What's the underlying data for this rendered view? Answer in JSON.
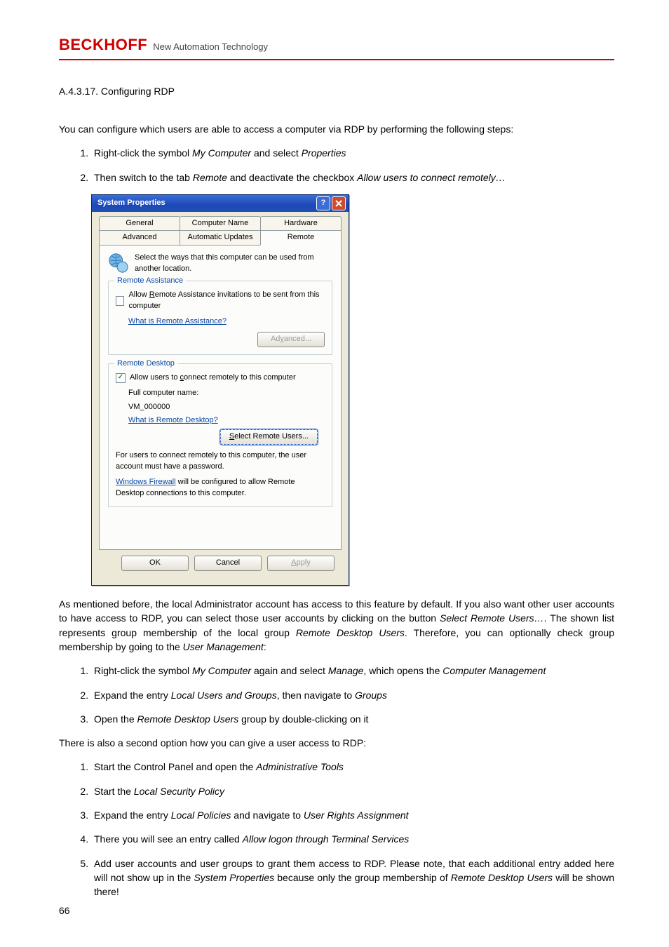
{
  "header": {
    "brand": "BECKHOFF",
    "tagline": "New Automation Technology"
  },
  "doc": {
    "section_heading": "A.4.3.17.  Configuring RDP",
    "intro": "You can configure which users are able to access a computer via RDP by performing the following steps:",
    "steps_a": {
      "s1_a": "Right-click the symbol ",
      "s1_b": "My Computer",
      "s1_c": " and select ",
      "s1_d": "Properties",
      "s2_a": "Then switch to the tab ",
      "s2_b": "Remote",
      "s2_c": " and deactivate the checkbox ",
      "s2_d": "Allow users to connect remotely…"
    },
    "after_dialog_a": "As mentioned before, the local Administrator account has access to this feature by default. If you also want other user accounts to have access to RDP, you can select those user accounts by clicking on the button ",
    "after_dialog_b": "Select Remote Users…",
    "after_dialog_c": ". The shown list represents group membership of the local group ",
    "after_dialog_d": "Remote Desktop Users",
    "after_dialog_e": ". Therefore, you can optionally check group membership by going to the ",
    "after_dialog_f": "User Management",
    "after_dialog_g": ":",
    "steps_b": {
      "s1_a": "Right-click the symbol ",
      "s1_b": "My Computer",
      "s1_c": " again and select ",
      "s1_d": "Manage",
      "s1_e": ", which opens the ",
      "s1_f": "Computer Management",
      "s2_a": "Expand the entry ",
      "s2_b": "Local Users and Groups",
      "s2_c": ", then navigate to ",
      "s2_d": "Groups",
      "s3_a": "Open the ",
      "s3_b": "Remote Desktop Users",
      "s3_c": " group by double-clicking on it"
    },
    "second_option": "There is also a second option how you can give a user access to RDP:",
    "steps_c": {
      "s1_a": "Start the Control Panel and open the ",
      "s1_b": "Administrative Tools",
      "s2_a": "Start the ",
      "s2_b": "Local Security Policy",
      "s3_a": "Expand the entry ",
      "s3_b": "Local Policies",
      "s3_c": " and navigate to ",
      "s3_d": "User Rights Assignment",
      "s4_a": "There you will see an entry called ",
      "s4_b": "Allow logon through Terminal Services",
      "s5_a": "Add user accounts and user groups to grant them access to RDP. Please note, that each additional entry added here will not show up in the ",
      "s5_b": "System Properties",
      "s5_c": " because only the group membership of ",
      "s5_d": "Remote Desktop Users",
      "s5_e": " will be shown there!"
    },
    "page_number": "66"
  },
  "dialog": {
    "title": "System Properties",
    "tabs_top": [
      "General",
      "Computer Name",
      "Hardware"
    ],
    "tabs_bot": [
      "Advanced",
      "Automatic Updates",
      "Remote"
    ],
    "active_tab": "Remote",
    "intro": "Select the ways that this computer can be used from another location.",
    "grp1": {
      "legend": "Remote Assistance",
      "chk_label_pre": "Allow ",
      "chk_label_u": "R",
      "chk_label_post": "emote Assistance invitations to be sent from this computer",
      "link": "What is Remote Assistance?",
      "adv_btn_pre": "Ad",
      "adv_btn_u": "v",
      "adv_btn_post": "anced..."
    },
    "grp2": {
      "legend": "Remote Desktop",
      "chk_label_pre": "Allow users to ",
      "chk_label_u": "c",
      "chk_label_post": "onnect remotely to this computer",
      "full_name_label": "Full computer name:",
      "full_name_value": "VM_000000",
      "link": "What is Remote Desktop?",
      "select_btn_pre": "",
      "select_btn_u": "S",
      "select_btn_post": "elect Remote Users...",
      "note": "For users to connect remotely to this computer, the user account must have a password.",
      "fw_link": "Windows Firewall",
      "fw_text": " will be configured to allow Remote Desktop connections to this computer."
    },
    "buttons": {
      "ok": "OK",
      "cancel": "Cancel",
      "apply_pre": "",
      "apply_u": "A",
      "apply_post": "pply"
    }
  }
}
